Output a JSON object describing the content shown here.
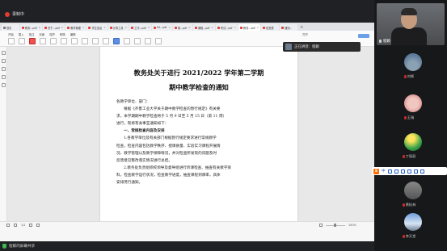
{
  "recording": {
    "label": "录制中",
    "color": "#e53935"
  },
  "browser": {
    "tabs": [
      {
        "label": "首页",
        "active": false
      },
      {
        "label": "教务...pdf",
        "active": false
      },
      {
        "label": "关于...pdf",
        "active": false
      },
      {
        "label": "教学管理",
        "active": false
      },
      {
        "label": "学生信息",
        "active": false
      },
      {
        "label": "计算工具",
        "active": false
      },
      {
        "label": "工作...pdf",
        "active": false
      },
      {
        "label": "Ed...pdf",
        "active": false
      },
      {
        "label": "第...pdf",
        "active": false
      },
      {
        "label": "课程...pdf",
        "active": false
      },
      {
        "label": "考试...pdf",
        "active": false
      },
      {
        "label": "教务...pdf",
        "active": true
      },
      {
        "label": "检查表",
        "active": false
      },
      {
        "label": "通知...",
        "active": false
      }
    ]
  },
  "toolbar": {
    "menus": [
      "开始",
      "插入",
      "批注",
      "页面",
      "保护",
      "转换",
      "编辑"
    ],
    "right_menu": "打开"
  },
  "speaking": {
    "label": "正在讲话：程颖"
  },
  "document": {
    "title_line1": "教务处关于进行 2021/2022 学年第二学期",
    "title_line2": "期中教学检查的通知",
    "salutation": "各教学单位、部门：",
    "para1": [
      "根据《齐鲁工业大学关于期中教学检查的暂行规定》有关要",
      "求，本学期期中教学检查将于 5 月 9 日至 5 月 15 日（第 11 周）",
      "进行，现将有关事宜通知如下："
    ],
    "section1": "一、常规检查内容及安排",
    "para2": [
      "1.各教学单位及有关部门根据暂行规定要求进行常规教学",
      "检查，检查内容包括教学秩序、授课质量、实验实习课程开展情",
      "况、教学管理以及教学保障情况，并对检查所发现的问题及时",
      "反馈意见整改落实情况进行总结。"
    ],
    "para3": [
      "2.教务处负责组织校领导及督导组进行听课检查、抽查有关教学资",
      "料，检查教学运行状况，检查教学进度，抽查课程到课率，具体",
      "安排另行通知。"
    ]
  },
  "statusbar": {
    "page": "1/1",
    "zoom": "100%"
  },
  "bottom": {
    "share_label": "程鲸的屏幕共享"
  },
  "main_video": {
    "name": "程颖"
  },
  "participants": [
    {
      "name": "刘辉"
    },
    {
      "name": "王瑞"
    },
    {
      "name": "丁丽丽"
    },
    {
      "name": "黄桂林"
    },
    {
      "name": "李天堂"
    }
  ],
  "ime": {
    "logo": "S",
    "mode": "中"
  }
}
